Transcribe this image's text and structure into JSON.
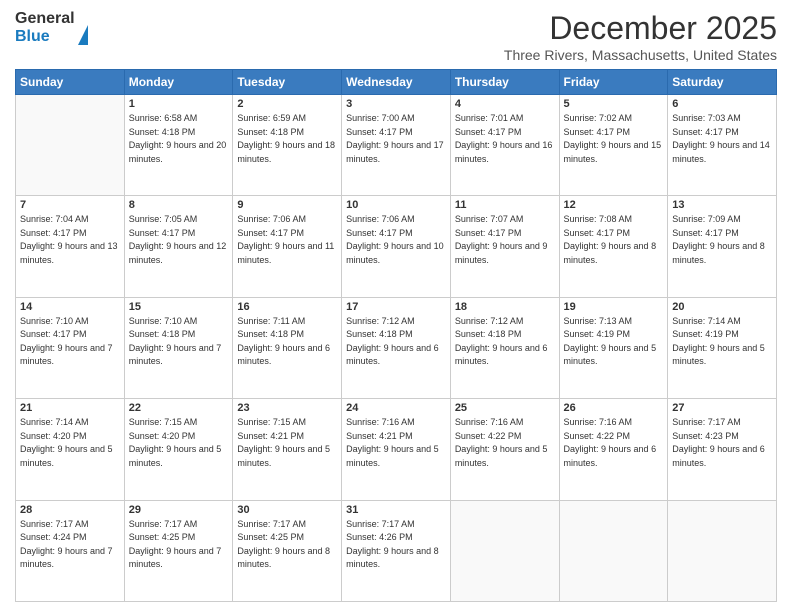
{
  "header": {
    "logo_general": "General",
    "logo_blue": "Blue",
    "title": "December 2025",
    "location": "Three Rivers, Massachusetts, United States"
  },
  "days_of_week": [
    "Sunday",
    "Monday",
    "Tuesday",
    "Wednesday",
    "Thursday",
    "Friday",
    "Saturday"
  ],
  "weeks": [
    [
      {
        "day": "",
        "sunrise": "",
        "sunset": "",
        "daylight": ""
      },
      {
        "day": "1",
        "sunrise": "Sunrise: 6:58 AM",
        "sunset": "Sunset: 4:18 PM",
        "daylight": "Daylight: 9 hours and 20 minutes."
      },
      {
        "day": "2",
        "sunrise": "Sunrise: 6:59 AM",
        "sunset": "Sunset: 4:18 PM",
        "daylight": "Daylight: 9 hours and 18 minutes."
      },
      {
        "day": "3",
        "sunrise": "Sunrise: 7:00 AM",
        "sunset": "Sunset: 4:17 PM",
        "daylight": "Daylight: 9 hours and 17 minutes."
      },
      {
        "day": "4",
        "sunrise": "Sunrise: 7:01 AM",
        "sunset": "Sunset: 4:17 PM",
        "daylight": "Daylight: 9 hours and 16 minutes."
      },
      {
        "day": "5",
        "sunrise": "Sunrise: 7:02 AM",
        "sunset": "Sunset: 4:17 PM",
        "daylight": "Daylight: 9 hours and 15 minutes."
      },
      {
        "day": "6",
        "sunrise": "Sunrise: 7:03 AM",
        "sunset": "Sunset: 4:17 PM",
        "daylight": "Daylight: 9 hours and 14 minutes."
      }
    ],
    [
      {
        "day": "7",
        "sunrise": "Sunrise: 7:04 AM",
        "sunset": "Sunset: 4:17 PM",
        "daylight": "Daylight: 9 hours and 13 minutes."
      },
      {
        "day": "8",
        "sunrise": "Sunrise: 7:05 AM",
        "sunset": "Sunset: 4:17 PM",
        "daylight": "Daylight: 9 hours and 12 minutes."
      },
      {
        "day": "9",
        "sunrise": "Sunrise: 7:06 AM",
        "sunset": "Sunset: 4:17 PM",
        "daylight": "Daylight: 9 hours and 11 minutes."
      },
      {
        "day": "10",
        "sunrise": "Sunrise: 7:06 AM",
        "sunset": "Sunset: 4:17 PM",
        "daylight": "Daylight: 9 hours and 10 minutes."
      },
      {
        "day": "11",
        "sunrise": "Sunrise: 7:07 AM",
        "sunset": "Sunset: 4:17 PM",
        "daylight": "Daylight: 9 hours and 9 minutes."
      },
      {
        "day": "12",
        "sunrise": "Sunrise: 7:08 AM",
        "sunset": "Sunset: 4:17 PM",
        "daylight": "Daylight: 9 hours and 8 minutes."
      },
      {
        "day": "13",
        "sunrise": "Sunrise: 7:09 AM",
        "sunset": "Sunset: 4:17 PM",
        "daylight": "Daylight: 9 hours and 8 minutes."
      }
    ],
    [
      {
        "day": "14",
        "sunrise": "Sunrise: 7:10 AM",
        "sunset": "Sunset: 4:17 PM",
        "daylight": "Daylight: 9 hours and 7 minutes."
      },
      {
        "day": "15",
        "sunrise": "Sunrise: 7:10 AM",
        "sunset": "Sunset: 4:18 PM",
        "daylight": "Daylight: 9 hours and 7 minutes."
      },
      {
        "day": "16",
        "sunrise": "Sunrise: 7:11 AM",
        "sunset": "Sunset: 4:18 PM",
        "daylight": "Daylight: 9 hours and 6 minutes."
      },
      {
        "day": "17",
        "sunrise": "Sunrise: 7:12 AM",
        "sunset": "Sunset: 4:18 PM",
        "daylight": "Daylight: 9 hours and 6 minutes."
      },
      {
        "day": "18",
        "sunrise": "Sunrise: 7:12 AM",
        "sunset": "Sunset: 4:18 PM",
        "daylight": "Daylight: 9 hours and 6 minutes."
      },
      {
        "day": "19",
        "sunrise": "Sunrise: 7:13 AM",
        "sunset": "Sunset: 4:19 PM",
        "daylight": "Daylight: 9 hours and 5 minutes."
      },
      {
        "day": "20",
        "sunrise": "Sunrise: 7:14 AM",
        "sunset": "Sunset: 4:19 PM",
        "daylight": "Daylight: 9 hours and 5 minutes."
      }
    ],
    [
      {
        "day": "21",
        "sunrise": "Sunrise: 7:14 AM",
        "sunset": "Sunset: 4:20 PM",
        "daylight": "Daylight: 9 hours and 5 minutes."
      },
      {
        "day": "22",
        "sunrise": "Sunrise: 7:15 AM",
        "sunset": "Sunset: 4:20 PM",
        "daylight": "Daylight: 9 hours and 5 minutes."
      },
      {
        "day": "23",
        "sunrise": "Sunrise: 7:15 AM",
        "sunset": "Sunset: 4:21 PM",
        "daylight": "Daylight: 9 hours and 5 minutes."
      },
      {
        "day": "24",
        "sunrise": "Sunrise: 7:16 AM",
        "sunset": "Sunset: 4:21 PM",
        "daylight": "Daylight: 9 hours and 5 minutes."
      },
      {
        "day": "25",
        "sunrise": "Sunrise: 7:16 AM",
        "sunset": "Sunset: 4:22 PM",
        "daylight": "Daylight: 9 hours and 5 minutes."
      },
      {
        "day": "26",
        "sunrise": "Sunrise: 7:16 AM",
        "sunset": "Sunset: 4:22 PM",
        "daylight": "Daylight: 9 hours and 6 minutes."
      },
      {
        "day": "27",
        "sunrise": "Sunrise: 7:17 AM",
        "sunset": "Sunset: 4:23 PM",
        "daylight": "Daylight: 9 hours and 6 minutes."
      }
    ],
    [
      {
        "day": "28",
        "sunrise": "Sunrise: 7:17 AM",
        "sunset": "Sunset: 4:24 PM",
        "daylight": "Daylight: 9 hours and 7 minutes."
      },
      {
        "day": "29",
        "sunrise": "Sunrise: 7:17 AM",
        "sunset": "Sunset: 4:25 PM",
        "daylight": "Daylight: 9 hours and 7 minutes."
      },
      {
        "day": "30",
        "sunrise": "Sunrise: 7:17 AM",
        "sunset": "Sunset: 4:25 PM",
        "daylight": "Daylight: 9 hours and 8 minutes."
      },
      {
        "day": "31",
        "sunrise": "Sunrise: 7:17 AM",
        "sunset": "Sunset: 4:26 PM",
        "daylight": "Daylight: 9 hours and 8 minutes."
      },
      {
        "day": "",
        "sunrise": "",
        "sunset": "",
        "daylight": ""
      },
      {
        "day": "",
        "sunrise": "",
        "sunset": "",
        "daylight": ""
      },
      {
        "day": "",
        "sunrise": "",
        "sunset": "",
        "daylight": ""
      }
    ]
  ]
}
